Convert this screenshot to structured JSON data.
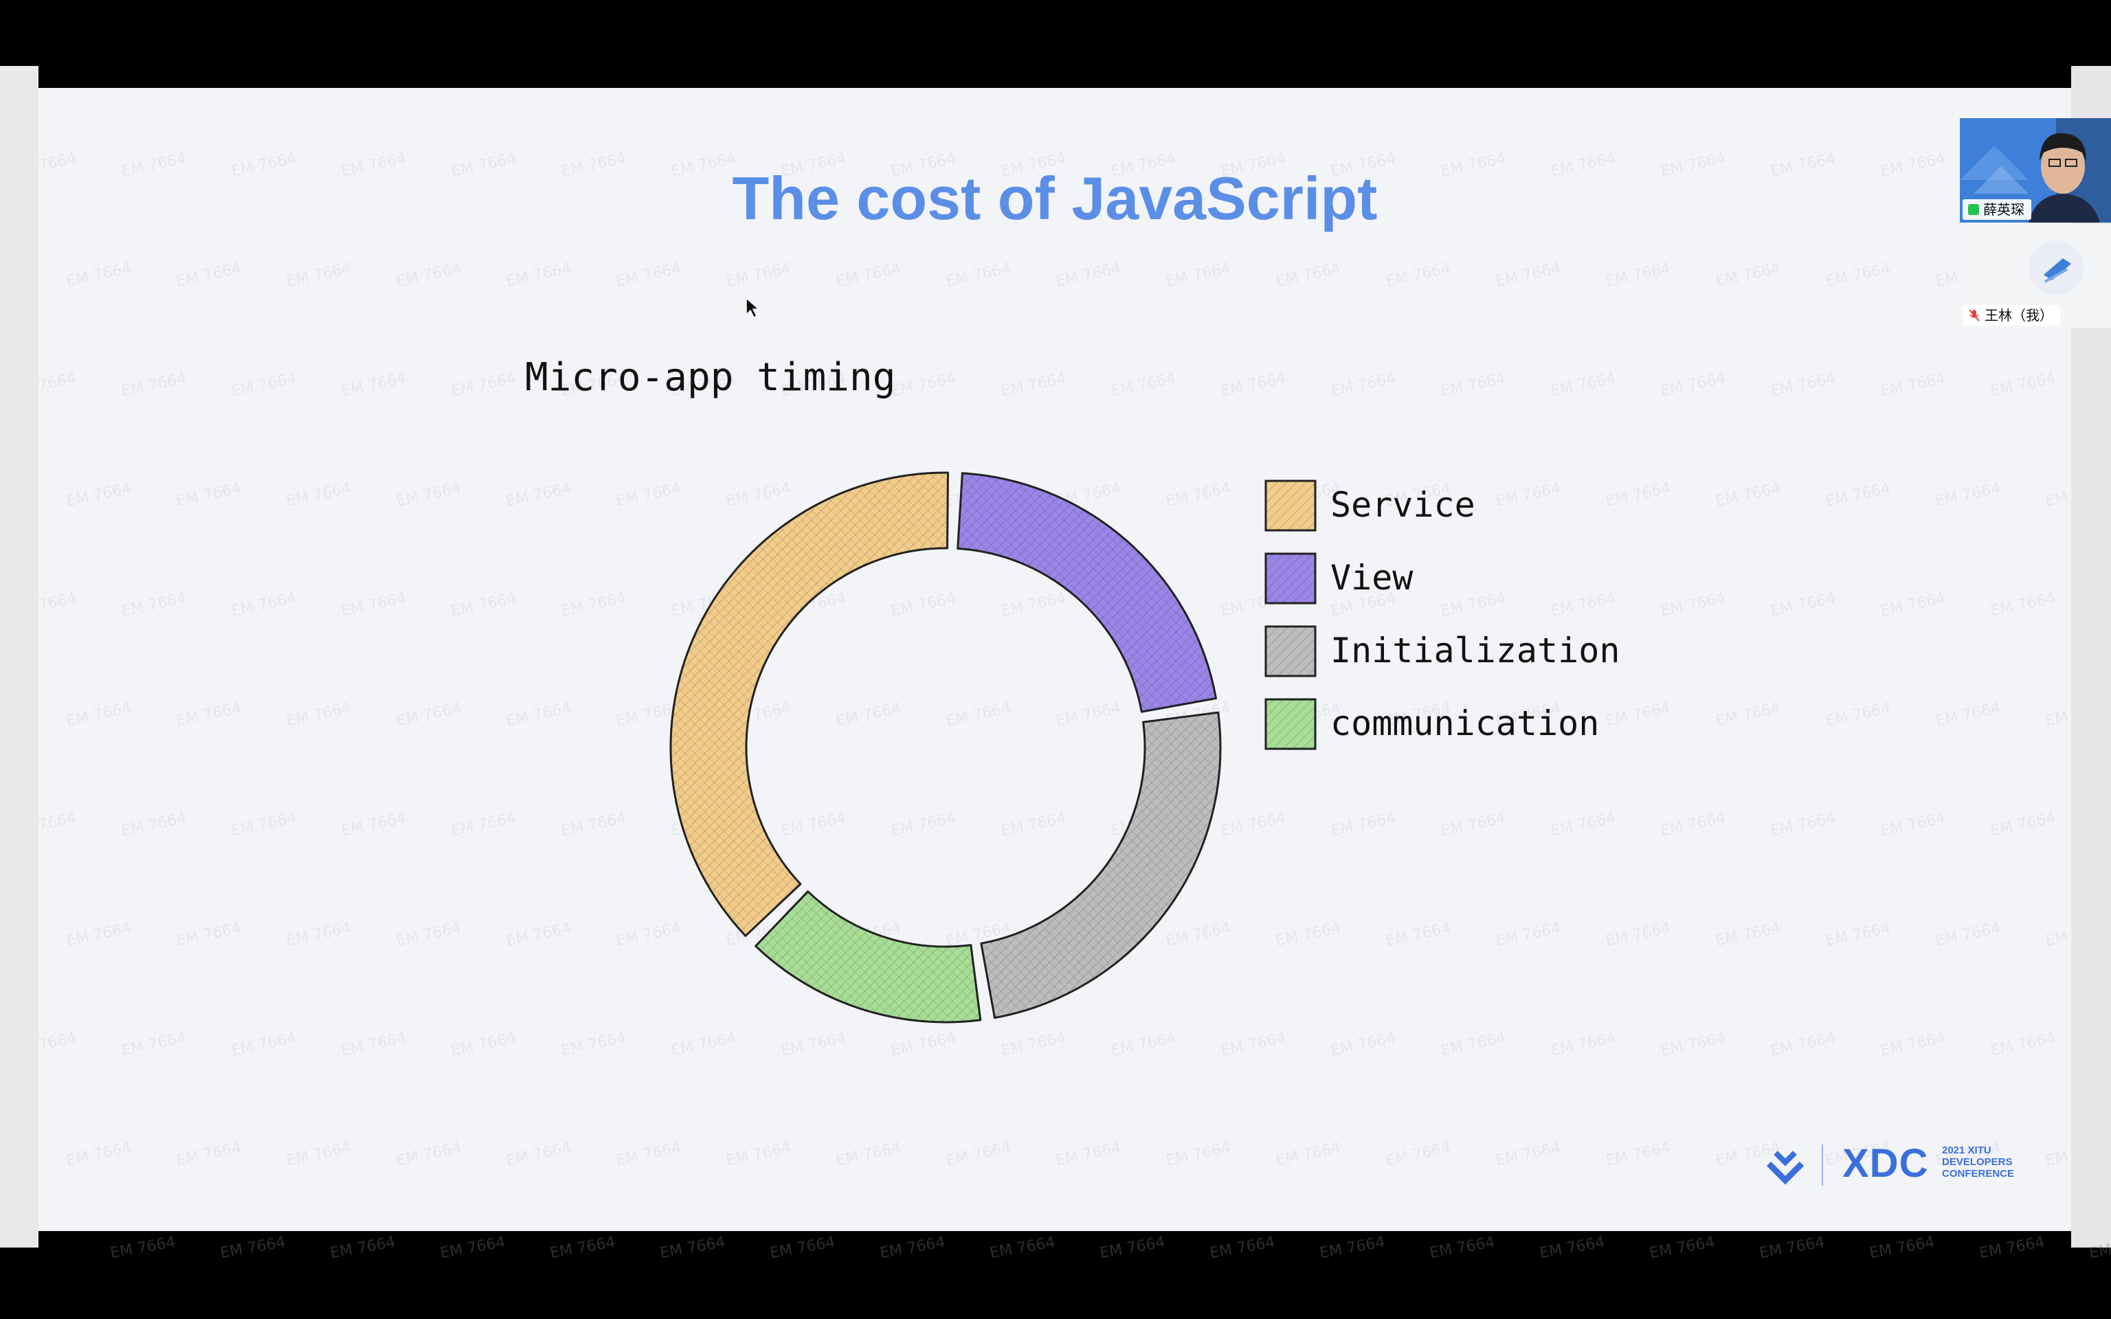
{
  "slide": {
    "title": "The cost of JavaScript",
    "chart_heading": "Micro-app timing",
    "watermark_text": "EM 7664"
  },
  "chart_data": {
    "type": "pie",
    "title": "Micro-app timing",
    "categories": [
      "Service",
      "View",
      "Initialization",
      "communication"
    ],
    "values": [
      38,
      22,
      25,
      15
    ],
    "colors": [
      "#f2cc8a",
      "#9b86e8",
      "#bdbdbd",
      "#a8dd96"
    ],
    "legend": "right"
  },
  "logo": {
    "brand": "XDC",
    "subtitle_lines": [
      "2021 XITU",
      "DEVELOPERS",
      "CONFERENCE"
    ]
  },
  "participants": [
    {
      "name": "薛英琛",
      "icon": "mic-on-icon"
    },
    {
      "name": "王林（我）",
      "icon": "mic-muted-icon"
    }
  ]
}
